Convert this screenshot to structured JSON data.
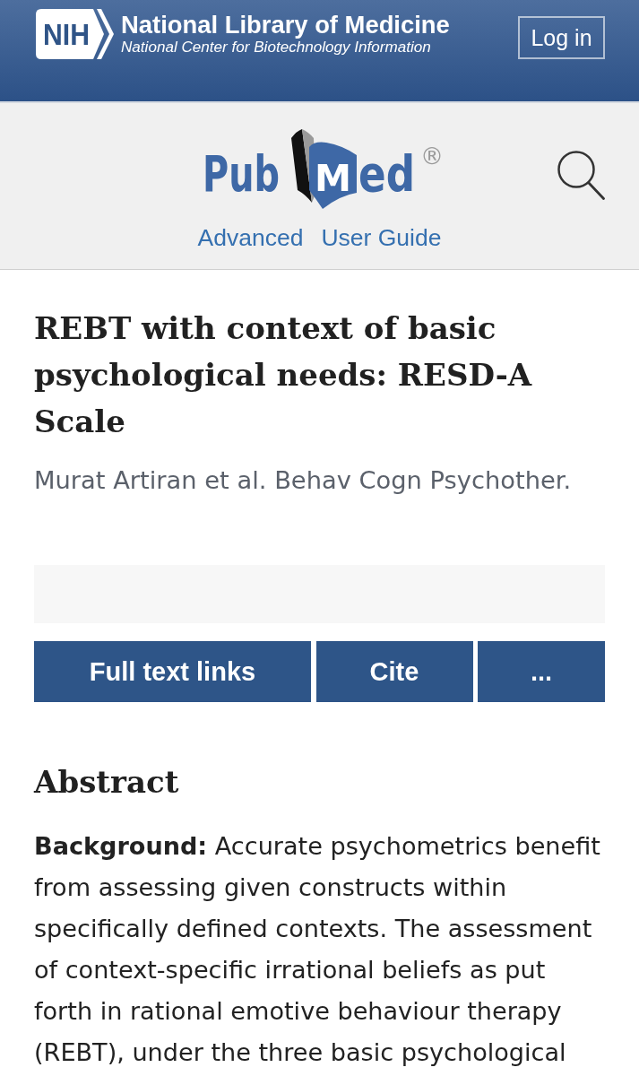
{
  "header": {
    "logo_text": "NIH",
    "title": "National Library of Medicine",
    "subtitle": "National Center for Biotechnology Information",
    "login_button": "Log in"
  },
  "pubmed_bar": {
    "logo": {
      "part_1": "Pub",
      "part_2": "M",
      "part_3": "ed",
      "mark": "®"
    },
    "links": [
      "Advanced",
      "User Guide"
    ]
  },
  "article": {
    "title": "REBT with context of basic psychological needs: RESD-A Scale",
    "authors": "Murat Artiran et al. Behav Cogn Psychother.",
    "actions": [
      {
        "label": "Full text links"
      },
      {
        "label": "Cite"
      },
      {
        "label": "..."
      }
    ]
  },
  "abstract": {
    "heading": "Abstract",
    "text": "**Background:** Accurate psychometrics benefit from assessing given constructs within specifically defined contexts. The assessment of context-specific irrational beliefs as put forth in rational emotive behaviour therapy (REBT), under the three basic psychological"
  }
}
